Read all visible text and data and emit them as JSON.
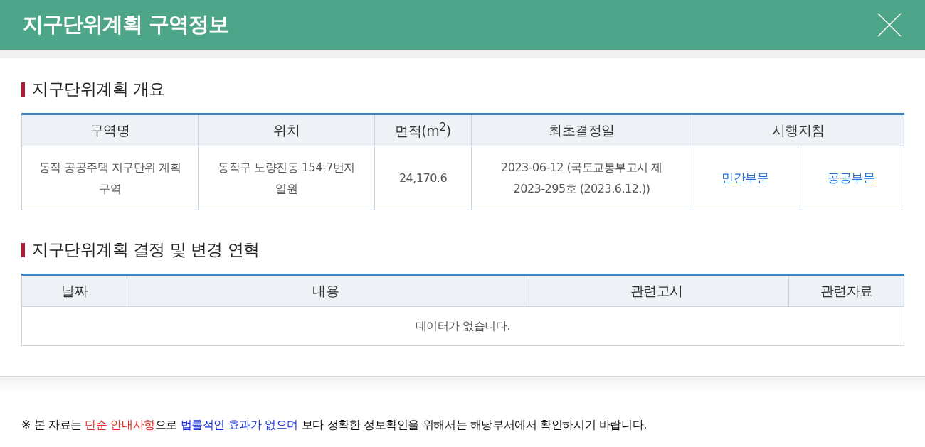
{
  "window": {
    "title": "지구단위계획 구역정보"
  },
  "overview": {
    "title": "지구단위계획 개요",
    "columns": [
      "구역명",
      "위치",
      "면적(m$^{2}$)",
      "최초결정일",
      "시행지침"
    ],
    "rows": [
      {
        "cells": [
          "동작 공공주택 지구단위 계획구역",
          "동작구 노량진동 154-7번지 일원",
          "24,170.6",
          "2023-06-12 (국토교통부고시 제2023-295호 (2023.6.12.))"
        ],
        "links": [
          "민간부문",
          "공공부문"
        ]
      }
    ]
  },
  "history": {
    "title": "지구단위계획 결정 및 변경 연혁",
    "columns": [
      "날짜",
      "내용",
      "관련고시",
      "관련자료"
    ],
    "empty_message": "데이터가 없습니다."
  },
  "note": [
    {
      "kind": "plain",
      "text": "※  본 자료는 "
    },
    {
      "kind": "alert",
      "text": "단순 안내사항"
    },
    {
      "kind": "plain",
      "text": "으로 "
    },
    {
      "kind": "emphasis",
      "text": "법률적인 효과가 없으며"
    },
    {
      "kind": "plain",
      "text": " 보다 정확한 정보확인을 위해서는 해당부서에서 확인하시기 바랍니다."
    }
  ]
}
